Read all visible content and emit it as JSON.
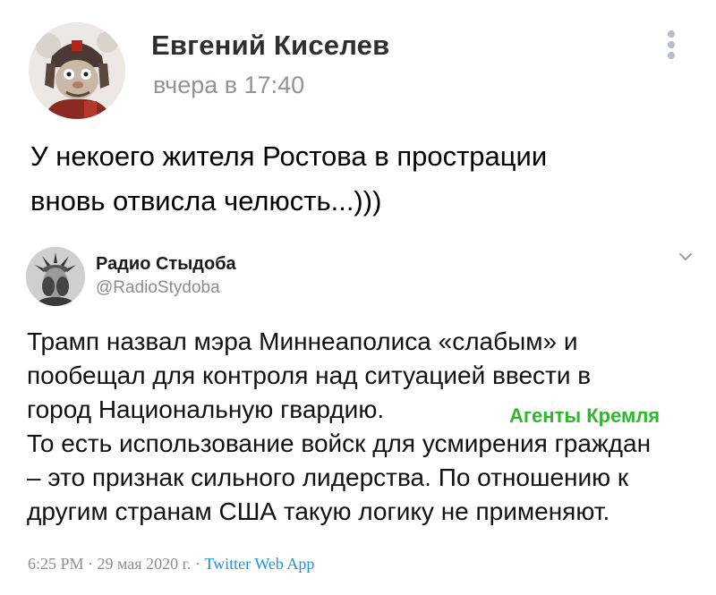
{
  "post": {
    "author": "Евгений Киселев",
    "time": "вчера в 17:40",
    "text_lines": [
      "У некоего жителя Ростова в прострации",
      "вновь отвисла челюсть...)))"
    ],
    "menu_icon": "more-vertical-icon"
  },
  "tweet": {
    "author_name": "Радио Стыдоба",
    "handle": "@RadioStydoba",
    "chevron_icon": "chevron-down-icon",
    "text_lines": [
      "Трамп назвал мэра Миннеаполиса «слабым» и",
      "пообещал для контроля над ситуацией ввести в",
      "город Национальную гвардию.",
      "То есть использование войск для усмирения граждан",
      "– это признак сильного лидерства. По отношению к",
      "другим странам США такую логику не применяют."
    ],
    "overlay_label": "Агенты Кремля",
    "overlay_color": "#2eb82e",
    "time": "6:25 PM",
    "date": "29 мая 2020 г.",
    "separator": "·",
    "source": "Twitter Web App",
    "source_color": "#1b95e0"
  }
}
